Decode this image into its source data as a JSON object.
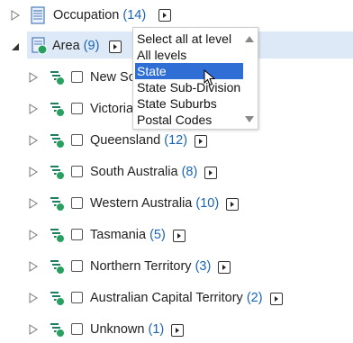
{
  "tree": {
    "occupation": {
      "label": "Occupation",
      "count": "(14)"
    },
    "area": {
      "label": "Area",
      "count": "(9)"
    },
    "children": [
      {
        "label": "New South Wales",
        "count": ""
      },
      {
        "label": "Victoria",
        "count": ""
      },
      {
        "label": "Queensland",
        "count": "(12)"
      },
      {
        "label": "South Australia",
        "count": "(8)"
      },
      {
        "label": "Western Australia",
        "count": "(10)"
      },
      {
        "label": "Tasmania",
        "count": "(5)"
      },
      {
        "label": "Northern Territory",
        "count": "(3)"
      },
      {
        "label": "Australian Capital Territory",
        "count": "(2)"
      },
      {
        "label": "Unknown",
        "count": "(1)"
      }
    ]
  },
  "dropdown": {
    "items": [
      "Select all at level",
      "All levels",
      "State",
      "State Sub-Division",
      "State Suburbs",
      "Postal Codes"
    ],
    "selected": "State"
  },
  "colors": {
    "count": "#1a64b8",
    "highlight": "#dde9f7",
    "selected": "#2f6fd5"
  },
  "icons": {
    "expander": "triangle-right-icon",
    "expanded": "triangle-down-icon",
    "table": "table-icon",
    "hierarchy": "hierarchy-node-icon",
    "submenu": "arrow-button-icon"
  }
}
